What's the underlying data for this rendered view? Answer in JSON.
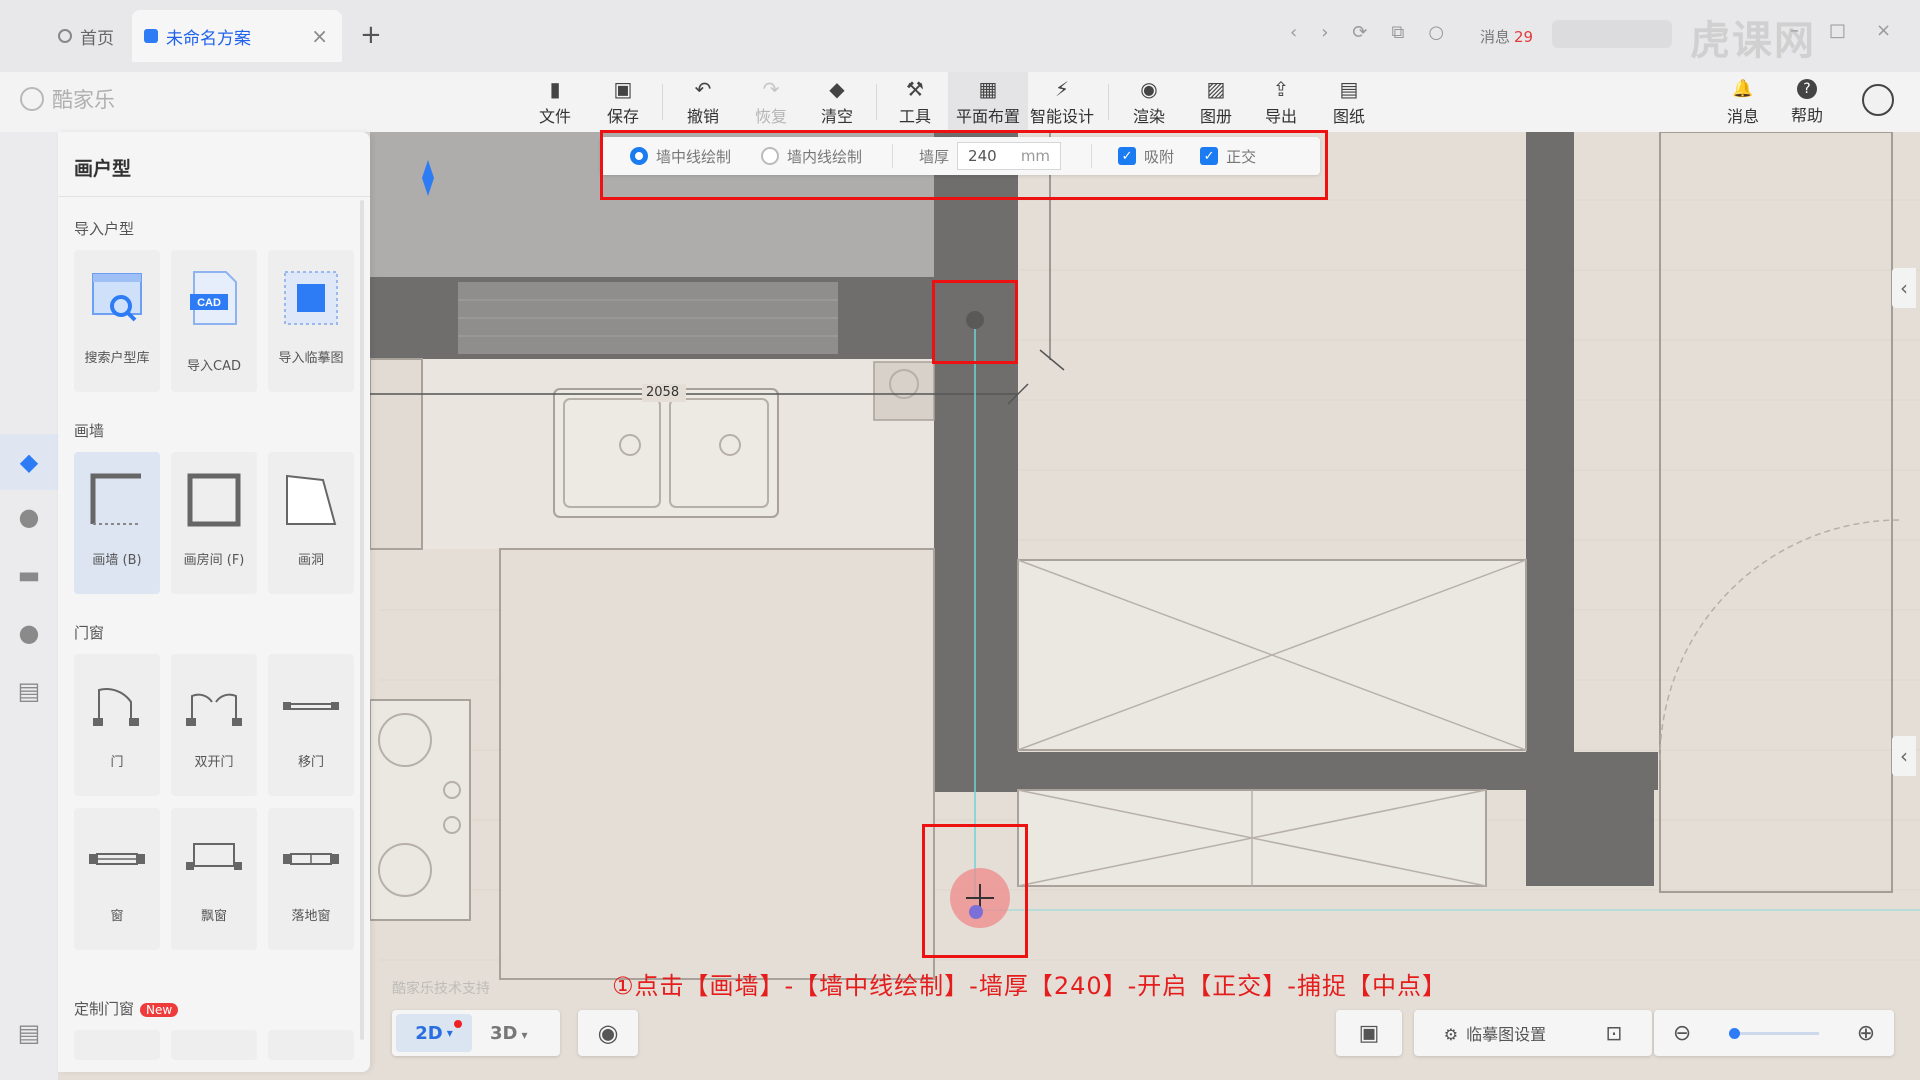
{
  "browser": {
    "tabs": [
      {
        "label": "首页"
      },
      {
        "label": "未命名方案"
      }
    ],
    "close_glyph": "×",
    "new_tab_glyph": "+",
    "nav_glyphs": [
      "‹",
      "›",
      "⟳",
      "⧉",
      "○"
    ],
    "message_label": "消息",
    "message_count": "29",
    "window_glyphs": [
      "–",
      "□",
      "×"
    ],
    "watermark": "虎课网"
  },
  "app": {
    "logo_text": "酷家乐",
    "toolbar": [
      {
        "label": "文件",
        "icon": "file-icon",
        "glyph": "▮"
      },
      {
        "label": "保存",
        "icon": "save-icon",
        "glyph": "▣"
      },
      {
        "label": "撤销",
        "icon": "undo-icon",
        "glyph": "↶"
      },
      {
        "label": "恢复",
        "icon": "redo-icon",
        "glyph": "↷"
      },
      {
        "label": "清空",
        "icon": "eraser-icon",
        "glyph": "◆"
      },
      {
        "label": "工具",
        "icon": "wrench-icon",
        "glyph": "⚒"
      },
      {
        "label": "平面布置",
        "icon": "layout-icon",
        "glyph": "▦"
      },
      {
        "label": "智能设计",
        "icon": "lightning-icon",
        "glyph": "⚡"
      },
      {
        "label": "渲染",
        "icon": "camera-icon",
        "glyph": "◉"
      },
      {
        "label": "图册",
        "icon": "album-icon",
        "glyph": "▨"
      },
      {
        "label": "导出",
        "icon": "export-icon",
        "glyph": "⇪"
      },
      {
        "label": "图纸",
        "icon": "drawing-icon",
        "glyph": "▤"
      }
    ],
    "right_buttons": [
      {
        "label": "消息",
        "icon": "bell-icon",
        "glyph": "🔔"
      },
      {
        "label": "帮助",
        "icon": "help-icon",
        "glyph": "?"
      }
    ]
  },
  "options_bar": {
    "mode_center": "墙中线绘制",
    "mode_inner": "墙内线绘制",
    "thickness_label": "墙厚",
    "thickness_value": "240",
    "thickness_unit": "mm",
    "snap_label": "吸附",
    "ortho_label": "正交",
    "check_glyph": "✓"
  },
  "panel": {
    "title": "画户型",
    "sections": {
      "import": "导入户型",
      "wall": "画墙",
      "door": "门窗",
      "custom": "定制门窗"
    },
    "new_badge": "New",
    "import_items": [
      {
        "label": "搜索户型库"
      },
      {
        "label": "导入CAD",
        "badge": "CAD"
      },
      {
        "label": "导入临摹图"
      }
    ],
    "wall_items": [
      {
        "label": "画墙 (B)"
      },
      {
        "label": "画房间 (F)"
      },
      {
        "label": "画洞"
      }
    ],
    "door_items": [
      {
        "label": "门"
      },
      {
        "label": "双开门"
      },
      {
        "label": "移门"
      },
      {
        "label": "窗"
      },
      {
        "label": "飘窗"
      },
      {
        "label": "落地窗"
      }
    ]
  },
  "canvas": {
    "dimension": "2058",
    "faint_text": "酷家乐技术支持"
  },
  "bottom": {
    "view_2d": "2D",
    "view_3d": "3D",
    "caret": "▾",
    "ref_settings": "临摹图设置",
    "zoom_level": 0.0
  },
  "subtitle": "①点击【画墙】-【墙中线绘制】-墙厚【240】-开启【正交】-捕捉【中点】",
  "colors": {
    "accent": "#1a7cf0",
    "highlight": "#ee1111",
    "wall": "#6f6e6d",
    "floor": "#e4ded6"
  }
}
